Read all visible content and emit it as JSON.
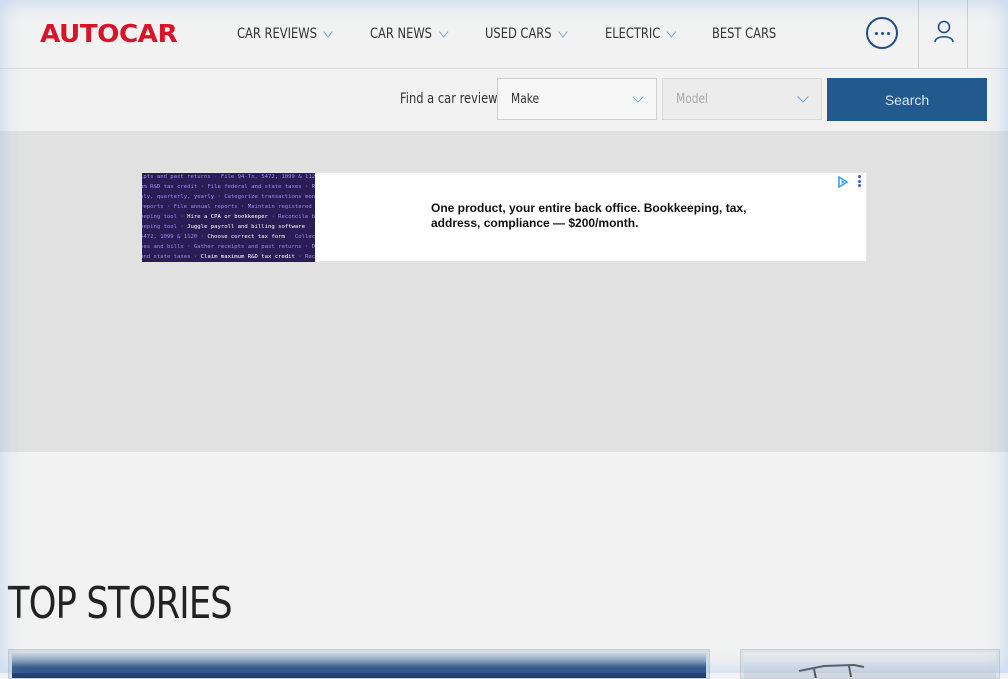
{
  "header": {
    "logo": "AUTOCAR",
    "nav": [
      {
        "label": "CAR REVIEWS",
        "has_dropdown": true
      },
      {
        "label": "CAR NEWS",
        "has_dropdown": true
      },
      {
        "label": "USED CARS",
        "has_dropdown": true
      },
      {
        "label": "ELECTRIC",
        "has_dropdown": true
      },
      {
        "label": "BEST CARS",
        "has_dropdown": false
      }
    ],
    "icons": {
      "more": "more-options-icon",
      "user": "user-account-icon"
    }
  },
  "finder": {
    "label": "Find a car review",
    "make": "Make",
    "model": "Model",
    "search": "Search"
  },
  "ad": {
    "text": "One product, your entire back office. Bookkeeping, tax, address, compliance — $200/month."
  },
  "sections": {
    "top_stories": "TOP STORIES"
  },
  "colors": {
    "brand": "#d6152a",
    "accent": "#225a8e",
    "chevron": "#6aa4d8"
  }
}
